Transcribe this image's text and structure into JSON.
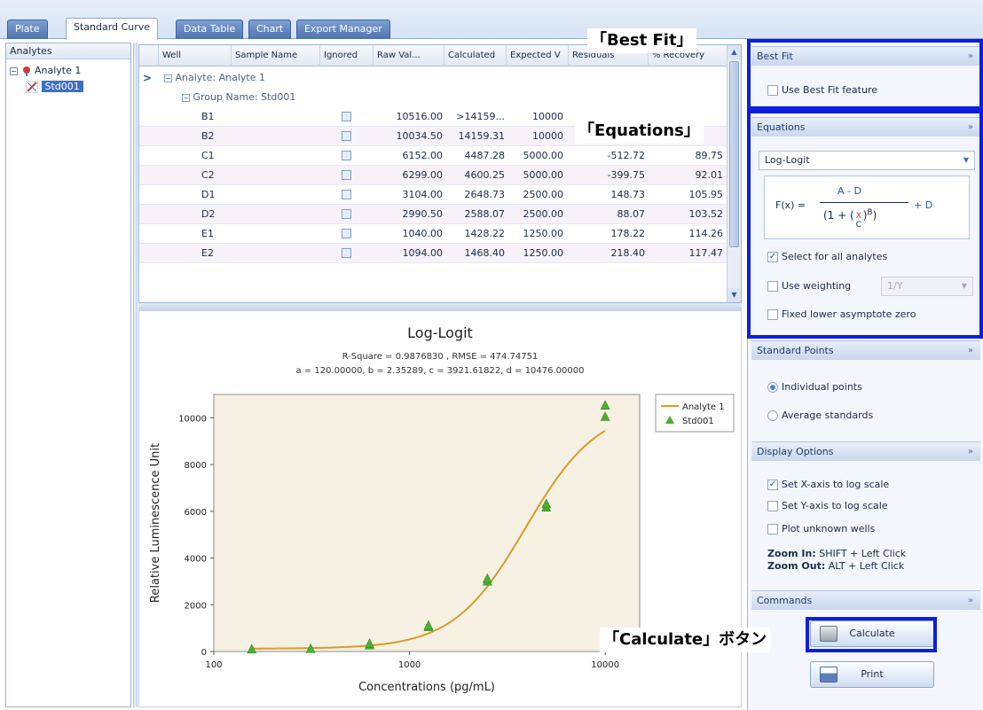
{
  "tabs": [
    "Plate",
    "Standard Curve",
    "Data Table",
    "Chart",
    "Export Manager"
  ],
  "active_tab_index": 1,
  "analytes_panel": {
    "title": "Analytes",
    "tree": {
      "analyte": "Analyte 1",
      "standard": "Std001"
    }
  },
  "grid": {
    "columns": [
      "Well",
      "Sample Name",
      "Ignored",
      "Raw Val...",
      "Calculated",
      "Expected V",
      "Residuals",
      "% Recovery"
    ],
    "group_analyte": "Analyte: Analyte 1",
    "group_name": "Group Name: Std001",
    "rows": [
      {
        "well": "B1",
        "raw": "10516.00",
        "calc": ">14159...",
        "expected": "10000",
        "resid": "",
        "recovery": ""
      },
      {
        "well": "B2",
        "raw": "10034.50",
        "calc": "14159.31",
        "expected": "10000",
        "resid": "",
        "recovery": ""
      },
      {
        "well": "C1",
        "raw": "6152.00",
        "calc": "4487.28",
        "expected": "5000.00",
        "resid": "-512.72",
        "recovery": "89.75"
      },
      {
        "well": "C2",
        "raw": "6299.00",
        "calc": "4600.25",
        "expected": "5000.00",
        "resid": "-399.75",
        "recovery": "92.01"
      },
      {
        "well": "D1",
        "raw": "3104.00",
        "calc": "2648.73",
        "expected": "2500.00",
        "resid": "148.73",
        "recovery": "105.95"
      },
      {
        "well": "D2",
        "raw": "2990.50",
        "calc": "2588.07",
        "expected": "2500.00",
        "resid": "88.07",
        "recovery": "103.52"
      },
      {
        "well": "E1",
        "raw": "1040.00",
        "calc": "1428.22",
        "expected": "1250.00",
        "resid": "178.22",
        "recovery": "114.26"
      },
      {
        "well": "E2",
        "raw": "1094.00",
        "calc": "1468.40",
        "expected": "1250.00",
        "resid": "218.40",
        "recovery": "117.47"
      }
    ]
  },
  "chart_data": {
    "type": "scatter",
    "title": "Log-Logit",
    "subtitle_1": "R-Square = 0.9876830 , RMSE = 474.74751",
    "subtitle_2": "a = 120.00000, b = 2.35289, c = 3921.61822, d = 10476.00000",
    "xlabel": "Concentrations (pg/mL)",
    "ylabel": "Relative Luminescence Unit",
    "x_scale": "log",
    "xlim": [
      100,
      15000
    ],
    "ylim": [
      0,
      11000
    ],
    "x_ticks": [
      "100",
      "1000",
      "10000"
    ],
    "y_ticks": [
      "0",
      "2000",
      "4000",
      "6000",
      "8000",
      "10000"
    ],
    "legend_position": "top-right",
    "series": [
      {
        "name": "Analyte 1",
        "kind": "line",
        "color": "#d99a2b",
        "params": {
          "a": 120.0,
          "b": 2.35289,
          "c": 3921.61822,
          "d": 10476.0
        },
        "x_range": [
          156.25,
          10000
        ]
      },
      {
        "name": "Std001",
        "kind": "points",
        "color": "#4caf30",
        "points": [
          [
            156.25,
            80
          ],
          [
            312.5,
            100
          ],
          [
            625,
            250
          ],
          [
            625,
            320
          ],
          [
            1250,
            1040
          ],
          [
            1250,
            1094
          ],
          [
            2500,
            2990
          ],
          [
            2500,
            3104
          ],
          [
            5000,
            6152
          ],
          [
            5000,
            6299
          ],
          [
            10000,
            10034
          ],
          [
            10000,
            10516
          ]
        ]
      }
    ]
  },
  "right_panel": {
    "best_fit": {
      "title": "Best Fit",
      "use_label": "Use Best Fit feature",
      "checked": false
    },
    "equations": {
      "title": "Equations",
      "model": "Log-Logit",
      "formula_lhs": "F(x) =",
      "formula_num": "A - D",
      "formula_x": "X",
      "formula_c": "C",
      "formula_b": "B",
      "formula_rhs": "+ D",
      "select_all_label": "Select for all analytes",
      "select_all_checked": true,
      "weighting_label": "Use weighting",
      "weighting_value": "1/Y",
      "fixed_lower_label": "Fixed lower asymptote zero"
    },
    "standard_points": {
      "title": "Standard Points",
      "individual": "Individual points",
      "average": "Average standards"
    },
    "display_options": {
      "title": "Display Options",
      "xlog_label": "Set X-axis to log scale",
      "ylog_label": "Set Y-axis to log scale",
      "plot_unknown_label": "Plot unknown wells",
      "zoom_in_key": "Zoom In:",
      "zoom_in_val": "SHIFT + Left Click",
      "zoom_out_key": "Zoom Out:",
      "zoom_out_val": "ALT + Left Click"
    },
    "commands": {
      "title": "Commands",
      "calculate": "Calculate",
      "print": "Print"
    },
    "collapse_glyph": "»"
  },
  "annotations": {
    "best_fit": "「Best Fit」",
    "equations": "「Equations」",
    "calculate": "「Calculate」ボタン"
  },
  "colors": {
    "highlight": "#0a1fe0",
    "curve": "#d99a2b",
    "points": "#4caf30"
  }
}
